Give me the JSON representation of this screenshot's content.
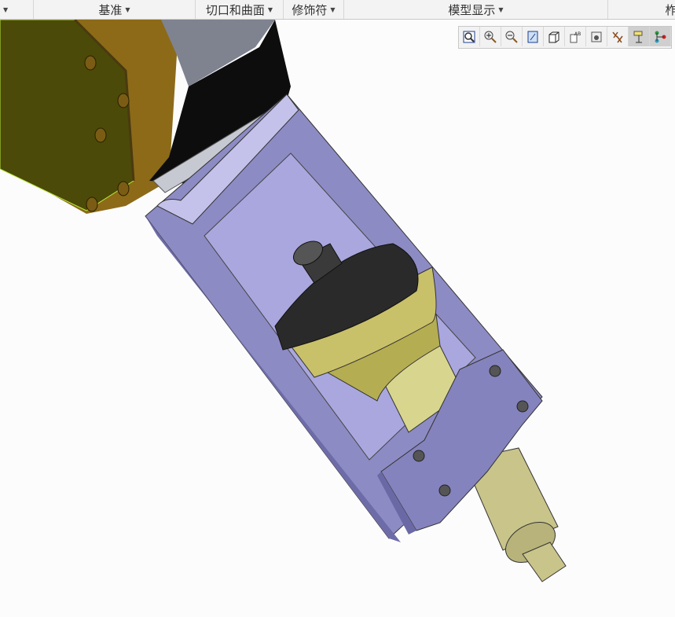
{
  "ribbon": {
    "groups": [
      {
        "label": ""
      },
      {
        "label": "基准"
      },
      {
        "label": "切口和曲面"
      },
      {
        "label": "修饰符"
      },
      {
        "label": "模型显示"
      },
      {
        "label": "柞"
      }
    ]
  },
  "toolbar": {
    "buttons": [
      {
        "icon": "refit-icon"
      },
      {
        "icon": "zoom-in-icon"
      },
      {
        "icon": "zoom-out-icon"
      },
      {
        "icon": "repaint-icon"
      },
      {
        "icon": "display-style-icon"
      },
      {
        "icon": "saved-orientations-icon"
      },
      {
        "icon": "view-manager-icon"
      },
      {
        "icon": "datum-display-icon"
      },
      {
        "icon": "annotation-display-icon"
      },
      {
        "icon": "spin-center-icon"
      }
    ]
  },
  "colors": {
    "housing": "#9a98d0",
    "arm": "#8a6a1a",
    "spindle": "#c9c27a"
  }
}
